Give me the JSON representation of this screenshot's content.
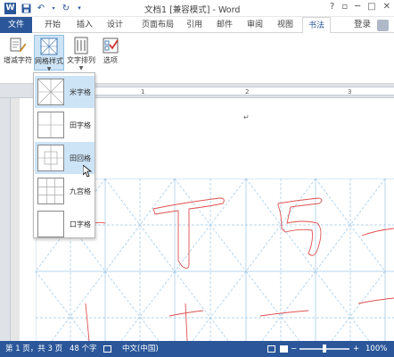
{
  "app": {
    "title": "文档1 [兼容模式] - Word",
    "logo_letter": "W"
  },
  "window_controls": [
    "?",
    "▫",
    "─",
    "□",
    "✕"
  ],
  "tabs": [
    {
      "label": "文件"
    },
    {
      "label": "开始"
    },
    {
      "label": "插入"
    },
    {
      "label": "设计"
    },
    {
      "label": "页面布局"
    },
    {
      "label": "引用"
    },
    {
      "label": "邮件"
    },
    {
      "label": "审阅"
    },
    {
      "label": "视图"
    },
    {
      "label": "书法"
    }
  ],
  "login_label": "登录",
  "ribbon": {
    "buttons": [
      {
        "label": "增减字符",
        "icon": "add-remove-chars-icon"
      },
      {
        "label": "网格样式",
        "icon": "grid-style-icon"
      },
      {
        "label": "文字排列",
        "icon": "text-arrange-icon"
      },
      {
        "label": "选项",
        "icon": "options-icon"
      }
    ]
  },
  "ruler": {
    "numbers": [
      "1",
      "2",
      "3"
    ]
  },
  "grid_style_menu": {
    "items": [
      {
        "label": "米字格"
      },
      {
        "label": "田字格"
      },
      {
        "label": "田回格"
      },
      {
        "label": "九宫格"
      },
      {
        "label": "口字格"
      }
    ]
  },
  "document": {
    "return_mark": "↵",
    "characters": [
      "丁",
      "丂"
    ]
  },
  "status": {
    "page": "第 1 页，共 3 页",
    "words": "48 个字",
    "language": "中文(中国)",
    "zoom": "100%"
  },
  "colors": {
    "accent": "#2b579a",
    "grid_line": "#9cc6e6",
    "stroke": "#e05050"
  }
}
